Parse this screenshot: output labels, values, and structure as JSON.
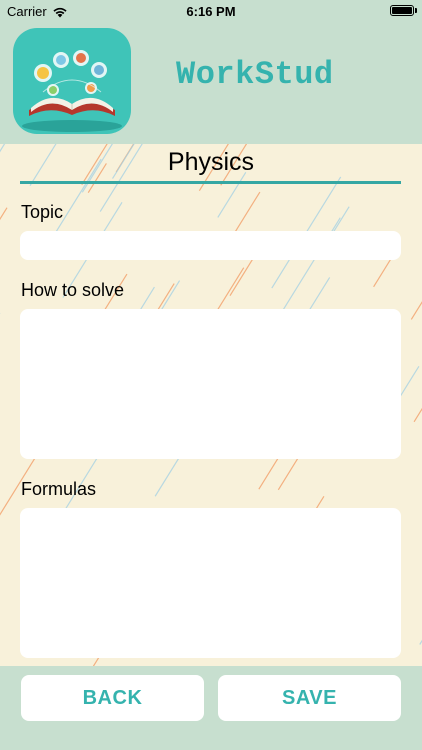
{
  "status_bar": {
    "carrier": "Carrier",
    "time": "6:16 PM"
  },
  "header": {
    "app_title": "WorkStud",
    "icon": "app-logo-book-icon"
  },
  "form": {
    "subject": "Physics",
    "fields": [
      {
        "label": "Topic",
        "value": "",
        "placeholder": ""
      },
      {
        "label": "How to solve",
        "value": "",
        "placeholder": ""
      },
      {
        "label": "Formulas",
        "value": "",
        "placeholder": ""
      }
    ]
  },
  "buttons": {
    "back": "BACK",
    "save": "SAVE"
  },
  "colors": {
    "header_background": "#c7dfcf",
    "form_background": "#f8f1da",
    "accent": "#35b3ae",
    "stripe_orange": "#f2a06a",
    "stripe_blue": "#a9d3e3"
  }
}
